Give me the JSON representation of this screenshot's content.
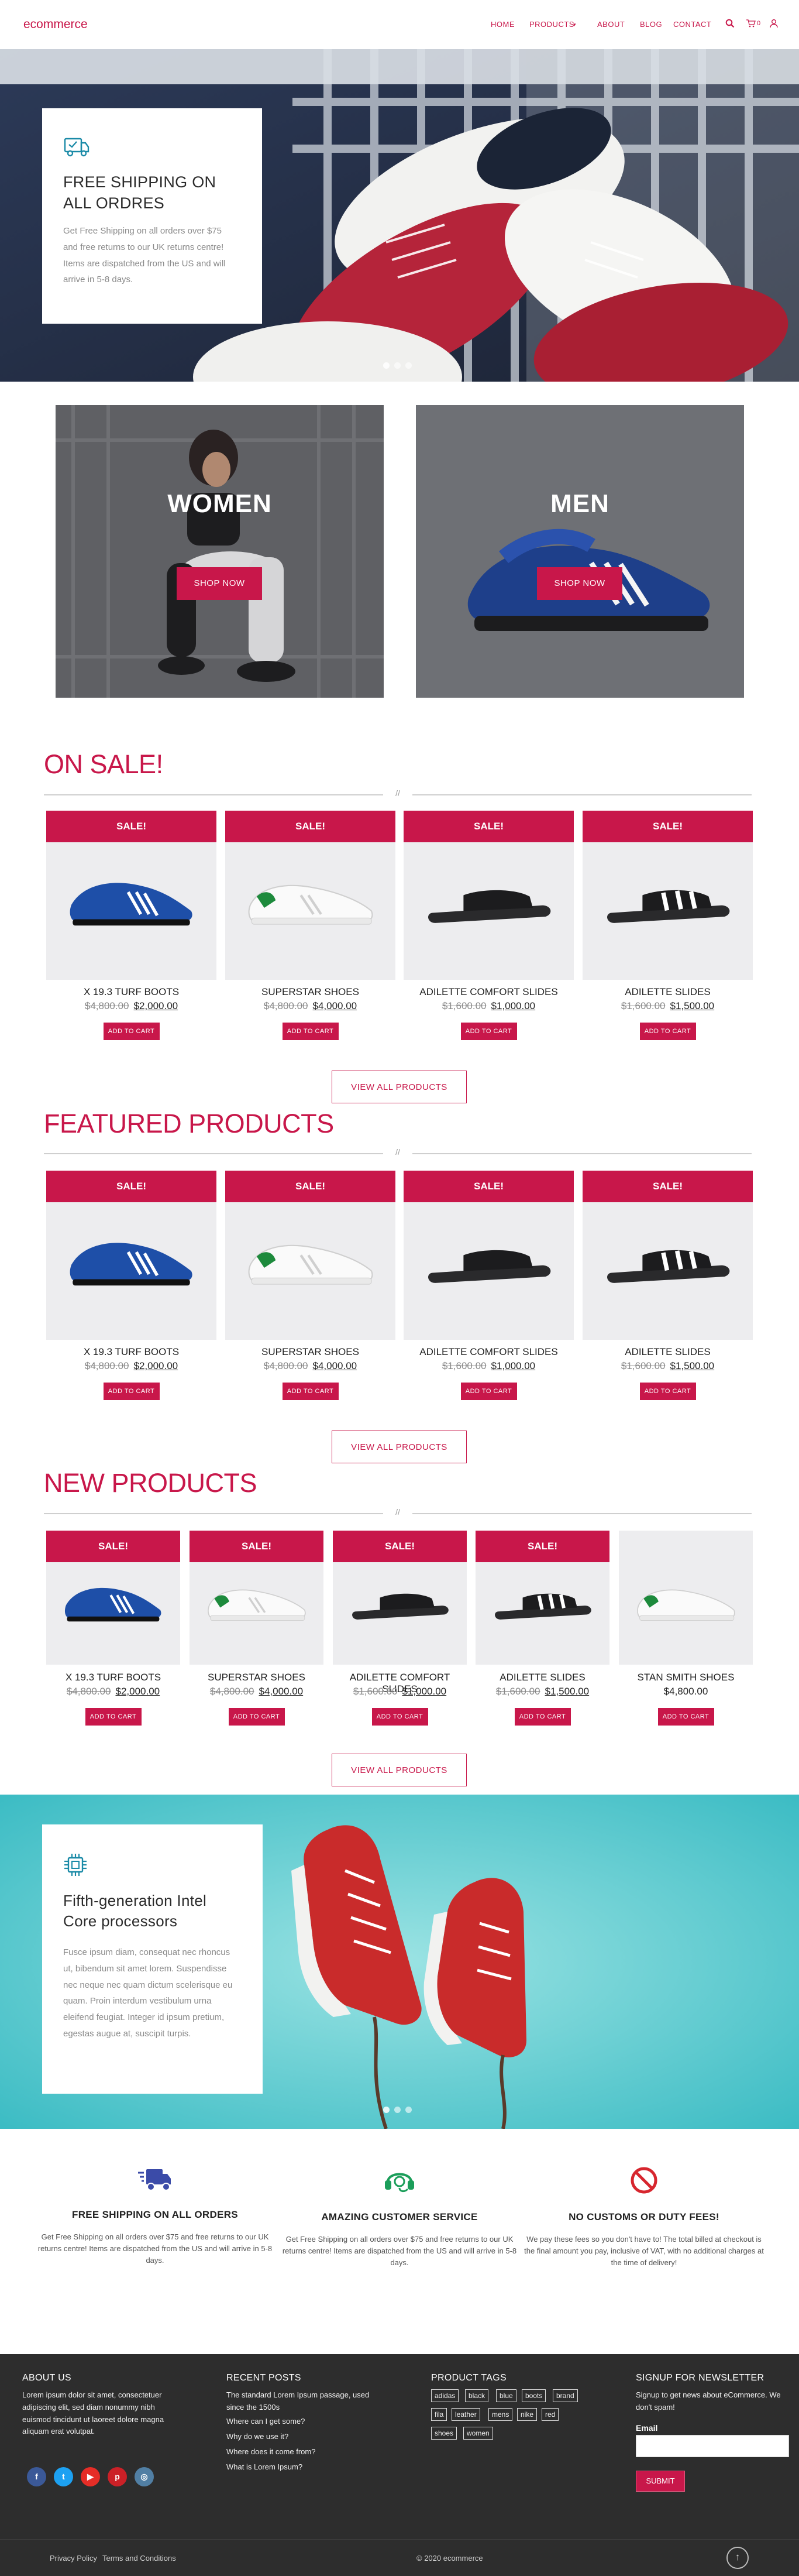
{
  "header": {
    "logo": "ecommerce",
    "nav": [
      "HOME",
      "PRODUCTS",
      "ABOUT",
      "BLOG",
      "CONTACT"
    ],
    "cart_count": "0"
  },
  "hero": {
    "title_line1": "FREE SHIPPING ON",
    "title_line2": "ALL ORDRES",
    "text": "Get Free Shipping on all orders over $75 and free returns to our UK returns centre! Items are dispatched from the US and will arrive in 5-8 days."
  },
  "categories": {
    "women_label": "WOMEN",
    "men_label": "MEN",
    "shop_now": "SHOP NOW"
  },
  "sections": {
    "on_sale": "ON SALE!",
    "featured": "FEATURED PRODUCTS",
    "new_products": "NEW PRODUCTS",
    "divider_mark": "//",
    "view_all": "VIEW ALL PRODUCTS",
    "sale_label": "SALE!",
    "add_to_cart": "ADD TO CART"
  },
  "products": [
    {
      "name": "X 19.3 TURF BOOTS",
      "old_price": "$4,800.00",
      "price": "$2,000.00",
      "sale": true
    },
    {
      "name": "SUPERSTAR SHOES",
      "old_price": "$4,800.00",
      "price": "$4,000.00",
      "sale": true
    },
    {
      "name": "ADILETTE COMFORT SLIDES",
      "old_price": "$1,600.00",
      "price": "$1,000.00",
      "sale": true
    },
    {
      "name": "ADILETTE SLIDES",
      "old_price": "$1,600.00",
      "price": "$1,500.00",
      "sale": true
    },
    {
      "name": "STAN SMITH SHOES",
      "old_price": "",
      "price": "$4,800.00",
      "sale": false
    }
  ],
  "promo": {
    "title_line1": "Fifth-generation Intel",
    "title_line2": "Core processors",
    "text": "Fusce ipsum diam, consequat nec rhoncus ut, bibendum sit amet lorem. Suspendisse nec neque nec quam dictum scelerisque eu quam. Proin interdum vestibulum urna eleifend feugiat. Integer id ipsum pretium, egestas augue at, suscipit turpis."
  },
  "features": [
    {
      "icon": "truck-icon",
      "title": "FREE SHIPPING ON ALL ORDERS",
      "text": "Get Free Shipping on all orders over $75 and free returns to our UK returns centre! Items are dispatched from the US and will arrive in 5-8 days.",
      "color": "#3b4ba8"
    },
    {
      "icon": "headset-icon",
      "title": "AMAZING CUSTOMER SERVICE",
      "text": "Get Free Shipping on all orders over $75 and free returns to our UK returns centre! Items are dispatched from the US and will arrive in 5-8 days.",
      "color": "#1b9e5a"
    },
    {
      "icon": "no-duty-icon",
      "title": "NO CUSTOMS OR DUTY FEES!",
      "text": "We pay these fees so you don't have to! The total billed at checkout is the final amount you pay, inclusive of VAT, with no additional charges at the time of delivery!",
      "color": "#d7262e"
    }
  ],
  "footer": {
    "about_title": "ABOUT US",
    "about_text": "Lorem ipsum dolor sit amet, consectetuer adipiscing elit, sed diam nonummy nibh euismod tincidunt ut laoreet dolore magna aliquam erat volutpat.",
    "posts_title": "RECENT POSTS",
    "posts": [
      "The standard Lorem Ipsum passage, used since the 1500s",
      "Where can I get some?",
      "Why do we use it?",
      "Where does it come from?",
      "What is Lorem Ipsum?"
    ],
    "tags_title": "PRODUCT TAGS",
    "tags": [
      "adidas",
      "black",
      "blue",
      "boots",
      "brand",
      "fila",
      "leather",
      "mens",
      "nike",
      "red",
      "shoes",
      "women"
    ],
    "newsletter_title": "SIGNUP FOR NEWSLETTER",
    "newsletter_text": "Signup to get news about eCommerce. We don't spam!",
    "email_label": "Email",
    "submit": "SUBMIT"
  },
  "bottom": {
    "privacy": "Privacy Policy",
    "terms": "Terms and Conditions",
    "copyright": "© 2020 ecommerce"
  }
}
